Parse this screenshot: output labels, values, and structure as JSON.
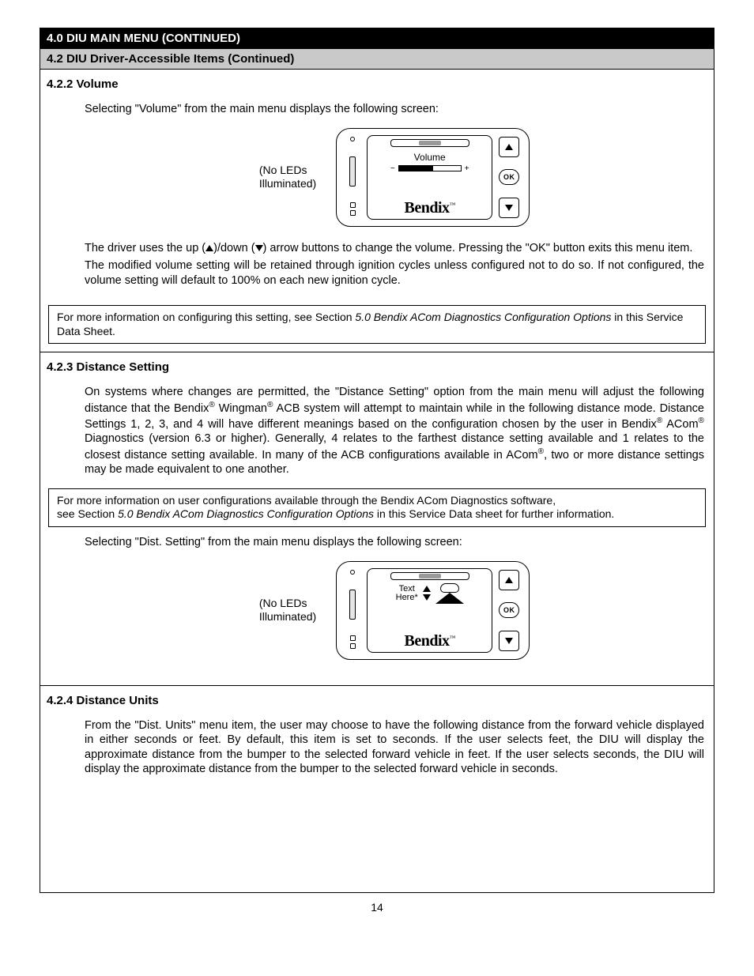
{
  "header": {
    "title_h1": "4.0 DIU MAIN MENU (CONTINUED)",
    "title_h2": "4.2 DIU Driver-Accessible Items (Continued)"
  },
  "volume": {
    "heading": "4.2.2 Volume",
    "intro": "Selecting \"Volume\" from the main menu displays the following screen:",
    "fig_label_l1": "(No LEDs",
    "fig_label_l2": "Illuminated)",
    "screen_title": "Volume",
    "minus": "−",
    "plus": "+",
    "brand": "Bendix",
    "tm": "™",
    "para1_a": "The driver uses the up (",
    "para1_b": ")/down (",
    "para1_c": ") arrow buttons to change the volume.  Pressing the \"OK\" button exits this menu item.",
    "para2": "The modified volume setting will be retained through ignition cycles unless configured not to do so.  If not configured, the volume setting will default to 100% on each new ignition cycle.",
    "note_a": "For more information on configuring this setting, see Section ",
    "note_b": "5.0 Bendix ACom Diagnostics Configuration Options",
    "note_c": " in this Service Data Sheet."
  },
  "dist_setting": {
    "heading": "4.2.3 Distance Setting",
    "para1_a": "On systems where changes are permitted, the \"Distance Setting\" option from the main menu will adjust the following distance that the Bendix",
    "para1_b": " Wingman",
    "para1_c": " ACB system will attempt to maintain while in the following distance mode.  Distance Settings 1, 2, 3, and 4 will have different meanings based on the configuration chosen by the user in Bendix",
    "para1_d": " ACom",
    "para1_e": " Diagnostics (version 6.3 or higher).  Generally, 4 relates to the farthest distance setting available and 1 relates to the closest distance setting available.  In many of the ACB configurations available in ACom",
    "para1_f": ", two or more distance settings may be made equivalent to one another.",
    "note_a": "For more information on user configurations available through the Bendix ACom Diagnostics software,",
    "note_b": "see Section ",
    "note_c": "5.0 Bendix ACom Diagnostics Configuration Options",
    "note_d": " in this Service Data sheet for further information.",
    "intro2": "Selecting \"Dist. Setting\" from the main menu displays the following screen:",
    "fig_label_l1": "(No LEDs",
    "fig_label_l2": "Illuminated)",
    "screen_text_l1": "Text",
    "screen_text_l2": "Here*",
    "brand": "Bendix",
    "tm": "™"
  },
  "dist_units": {
    "heading": "4.2.4 Distance Units",
    "para1": "From the \"Dist. Units\" menu item, the user may choose to have the following distance from the forward vehicle displayed in either seconds or feet.  By default, this item is set to seconds.  If the user selects feet, the DIU will display the approximate distance from the bumper to the selected forward vehicle in feet.  If the user selects seconds, the DIU will display the approximate distance from the bumper to the selected forward vehicle in seconds."
  },
  "page_number": "14"
}
